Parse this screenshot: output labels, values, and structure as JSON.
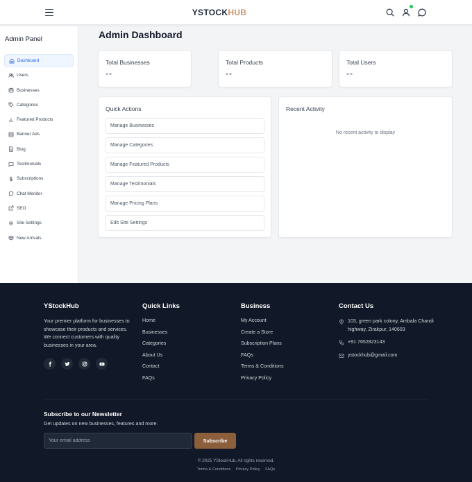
{
  "header": {
    "logo_part1": "YSTOCK",
    "logo_part2": "HUB",
    "icons": [
      "menu-icon",
      "search-icon",
      "user-icon",
      "chat-icon"
    ],
    "brand_accent": "#c8956d",
    "notification_color": "#22c55e"
  },
  "sidebar": {
    "title": "Admin Panel",
    "items": [
      {
        "label": "Dashboard",
        "icon": "home-icon",
        "active": true
      },
      {
        "label": "Users",
        "icon": "users-icon"
      },
      {
        "label": "Businesses",
        "icon": "briefcase-icon"
      },
      {
        "label": "Categories",
        "icon": "tag-icon"
      },
      {
        "label": "Featured Products",
        "icon": "chart-icon"
      },
      {
        "label": "Banner Ads",
        "icon": "image-icon"
      },
      {
        "label": "Blog",
        "icon": "document-icon"
      },
      {
        "label": "Testimonials",
        "icon": "message-icon"
      },
      {
        "label": "Subscriptions",
        "icon": "dollar-icon"
      },
      {
        "label": "Chat Monitor",
        "icon": "chat-bubble-icon"
      },
      {
        "label": "SEO",
        "icon": "external-link-icon"
      },
      {
        "label": "Site Settings",
        "icon": "gear-icon"
      },
      {
        "label": "New Arrivals",
        "icon": "box-icon"
      }
    ]
  },
  "main": {
    "title": "Admin Dashboard",
    "stats": [
      {
        "label": "Total Businesses",
        "value": "--"
      },
      {
        "label": "Total Products",
        "value": "--"
      },
      {
        "label": "Total Users",
        "value": "--"
      }
    ],
    "quick_actions": {
      "title": "Quick Actions",
      "items": [
        "Manage Businesses",
        "Manage Categories",
        "Manage Featured Products",
        "Manage Testimonials",
        "Manage Pricing Plans",
        "Edit Site Settings"
      ]
    },
    "recent_activity": {
      "title": "Recent Activity",
      "empty_text": "No recent activity to display"
    }
  },
  "footer": {
    "brand": {
      "title": "YStockHub",
      "description": "Your premier platform for businesses to showcase their products and services. We connect customers with quality businesses in your area."
    },
    "socials": [
      "facebook-icon",
      "twitter-icon",
      "instagram-icon",
      "youtube-icon"
    ],
    "quick_links": {
      "title": "Quick Links",
      "items": [
        "Home",
        "Businesses",
        "Categories",
        "About Us",
        "Contact",
        "FAQs"
      ]
    },
    "business": {
      "title": "Business",
      "items": [
        "My Account",
        "Create a Store",
        "Subscription Plans",
        "FAQs",
        "Terms & Conditions",
        "Privacy Policy"
      ]
    },
    "contact": {
      "title": "Contact Us",
      "address": "103, green park colony, Ambala Chandi highway, Zirakpur, 140603",
      "phone": "+91 7652823143",
      "email": "ystockhub@gmail.com"
    },
    "newsletter": {
      "title": "Subscribe to our Newsletter",
      "subtitle": "Get updates on new businesses, features and more.",
      "placeholder": "Your email address",
      "button": "Subscribe"
    },
    "copyright": "© 2025 YStockHub. All rights reserved.",
    "legal_links": [
      "Terms & Conditions",
      "Privacy Policy",
      "FAQs"
    ],
    "button_color": "#8b5e3c"
  }
}
